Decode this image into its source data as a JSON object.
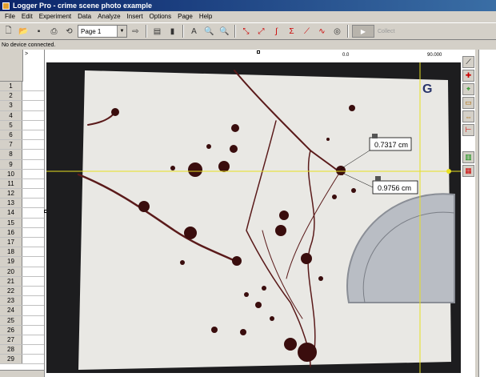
{
  "window": {
    "title": "Logger Pro - crime scene photo example"
  },
  "menu": [
    "File",
    "Edit",
    "Experiment",
    "Data",
    "Analyze",
    "Insert",
    "Options",
    "Page",
    "Help"
  ],
  "toolbar": {
    "page_value": "Page 1",
    "collect_label": "Collect"
  },
  "status": {
    "text": "No device connected."
  },
  "table": {
    "rows": [
      "1",
      "2",
      "3",
      "4",
      "5",
      "6",
      "7",
      "8",
      "9",
      "10",
      "11",
      "12",
      "13",
      "14",
      "15",
      "16",
      "17",
      "18",
      "19",
      "20",
      "21",
      "22",
      "23",
      "24",
      "25",
      "26",
      "27",
      "28",
      "29"
    ]
  },
  "graph": {
    "origin_label": "0.0",
    "x_label": "90.000",
    "measure_top": "0.7317 cm",
    "measure_bottom": "0.9756 cm",
    "photo_mark": "G"
  }
}
